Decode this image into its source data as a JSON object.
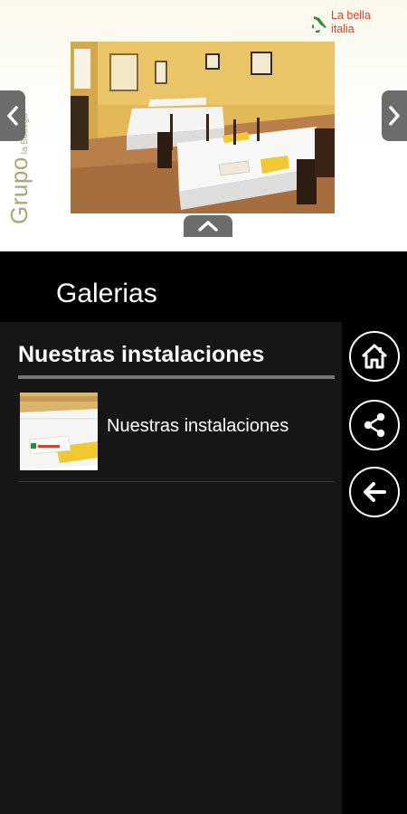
{
  "header": {
    "brand_main": "Grupo",
    "brand_sub": "la Bodega",
    "logo_line1": "La bella",
    "logo_line2": "italia",
    "photo_icon": "restaurant-dining-room-photo",
    "prev_icon": "chevron-left-icon",
    "next_icon": "chevron-right-icon",
    "collapse_icon": "chevron-up-icon"
  },
  "page": {
    "title": "Galerias"
  },
  "gallery": {
    "section_title": "Nuestras instalaciones",
    "items": [
      {
        "label": "Nuestras instalaciones",
        "thumb": "gallery-thumbnail"
      }
    ]
  },
  "rail": {
    "buttons": [
      {
        "icon": "home-icon"
      },
      {
        "icon": "share-icon"
      },
      {
        "icon": "back-arrow-icon"
      }
    ]
  },
  "colors": {
    "logo_red": "#d6412d",
    "brand_olive": "#a9a67a",
    "content_bg": "#161616",
    "tab_gray": "#6c6c6c"
  }
}
